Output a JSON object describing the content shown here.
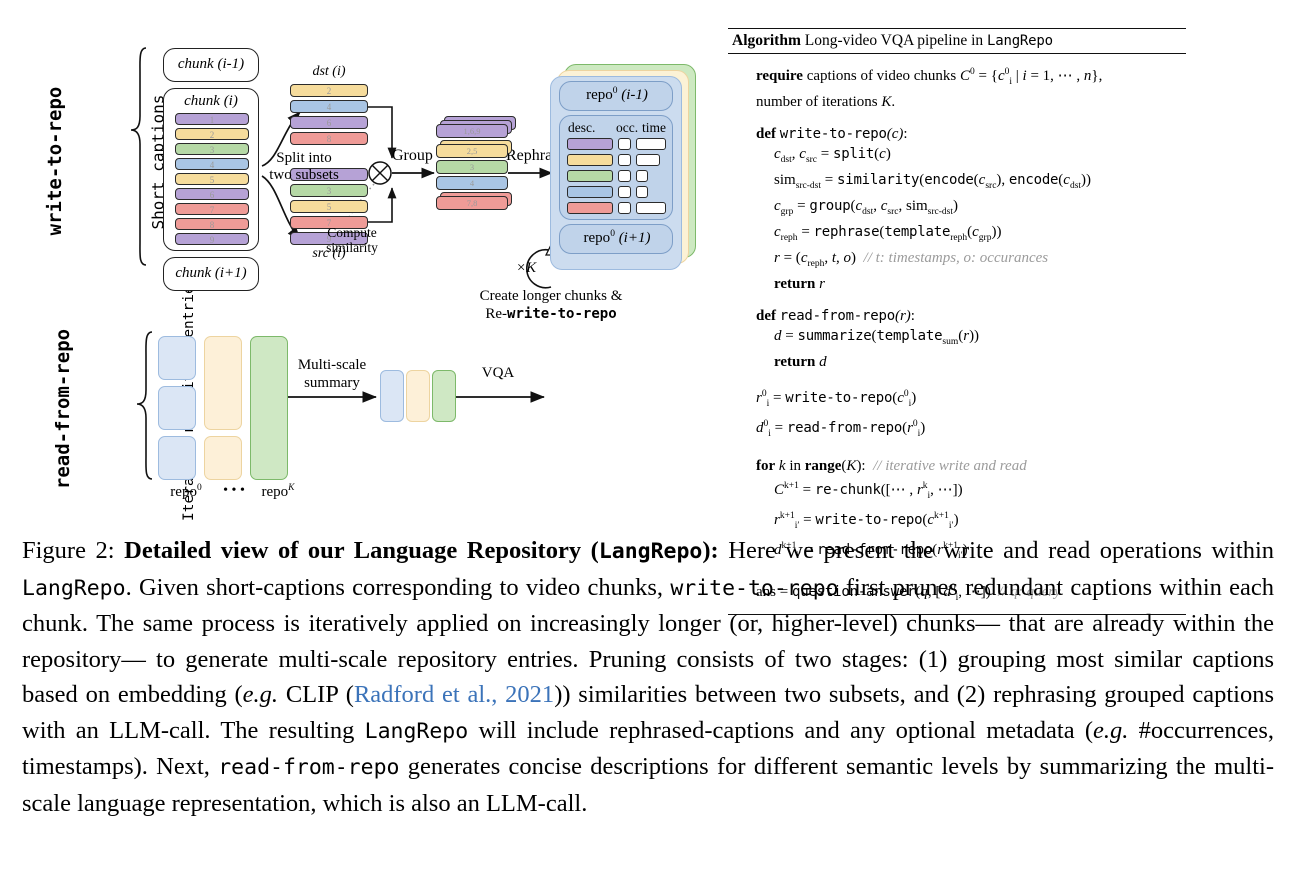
{
  "figure": {
    "label": "Figure 2:",
    "title_bold": "Detailed view of our Language Repository (",
    "title_mono": "LangRepo",
    "title_bold_end": "):",
    "body_1": " Here we present the write and read operations within ",
    "mono_1": "LangRepo",
    "body_2": ". Given short-captions corresponding to video chunks, ",
    "mono_2": "write-to-repo",
    "body_3": " first prunes redundant captions within each chunk. The same process is iteratively applied on increasingly longer (or, higher-level) chunks— that are already within the repository— to generate multi-scale repository entries. Pruning consists of two stages: (1) grouping most similar captions based on embedding (",
    "eg_1": "e.g.",
    "body_4": " CLIP (",
    "citation": "Radford et al., 2021",
    "body_5": ")) similarities between two subsets, and (2) rephrasing grouped captions with an LLM-call. The resulting ",
    "mono_3": "LangRepo",
    "body_6": " will include rephrased-captions and any optional metadata (",
    "eg_2": "e.g.",
    "body_7": " #occurrences, timestamps).  Next, ",
    "mono_4": "read-from-repo",
    "body_8": " generates concise descriptions for different semantic levels by summarizing the multi-scale language representation, which is also an LLM-call."
  },
  "diagram": {
    "write_section_label": "write-to-repo",
    "read_section_label": "read-from-repo",
    "short_captions_label": "Short captions",
    "iterative_entries_label": "Iterative repository entries",
    "chunk_prev": "chunk (i-1)",
    "chunk_cur": "chunk (i)",
    "chunk_next": "chunk (i+1)",
    "dst_label": "dst (i)",
    "src_label": "src (i)",
    "split_label_l1": "Split into",
    "split_label_l2": "two subsets",
    "similarity_op": "⊗",
    "compute_sim_l1": "Compute",
    "compute_sim_l2": "similarity",
    "group_label": "Group",
    "rephrase_label": "Rephrase",
    "repo_prev": "repo",
    "repo_prev_sup": "0",
    "repo_prev_idx": "(i-1)",
    "repo_next": "repo",
    "repo_next_sup": "0",
    "repo_next_idx": "(i+1)",
    "col_desc": "desc.",
    "col_occ": "occ.",
    "col_time": "time",
    "loop_label": "×K",
    "loop_cap_l1": "Create longer chunks &",
    "loop_cap_l2_pre": "Re-",
    "loop_cap_l2_mono": "write-to-repo",
    "multiscale_l1": "Multi-scale",
    "multiscale_l2": "summary",
    "vqa_label": "VQA",
    "repo0_label": "repo",
    "repo0_sup": "0",
    "dots": "• • •",
    "repoK_label": "repo",
    "repoK_sup": "K",
    "chunk_captions": [
      {
        "n": "1",
        "color": "#b6a2d6"
      },
      {
        "n": "2",
        "color": "#f6dc9c"
      },
      {
        "n": "3",
        "color": "#b6d9a6"
      },
      {
        "n": "4",
        "color": "#a9c5e4"
      },
      {
        "n": "5",
        "color": "#f6dc9c"
      },
      {
        "n": "6",
        "color": "#b6a2d6"
      },
      {
        "n": "7",
        "color": "#ef9b97"
      },
      {
        "n": "8",
        "color": "#ef9b97"
      },
      {
        "n": "9",
        "color": "#b6a2d6"
      }
    ],
    "dst_captions": [
      {
        "n": "2",
        "color": "#f6dc9c"
      },
      {
        "n": "4",
        "color": "#a9c5e4"
      },
      {
        "n": "6",
        "color": "#b6a2d6"
      },
      {
        "n": "8",
        "color": "#ef9b97"
      }
    ],
    "src_captions": [
      {
        "n": "1",
        "color": "#b6a2d6"
      },
      {
        "n": "3",
        "color": "#b6d9a6"
      },
      {
        "n": "5",
        "color": "#f6dc9c"
      },
      {
        "n": "7",
        "color": "#ef9b97"
      },
      {
        "n": "9",
        "color": "#b6a2d6"
      }
    ],
    "grouped_captions": [
      {
        "n": "1,6,9",
        "color": "#b6a2d6",
        "stack": 3
      },
      {
        "n": "2,5",
        "color": "#f6dc9c",
        "stack": 2
      },
      {
        "n": "3",
        "color": "#b6d9a6",
        "stack": 1
      },
      {
        "n": "4",
        "color": "#a9c5e4",
        "stack": 1
      },
      {
        "n": "7,8",
        "color": "#ef9b97",
        "stack": 2
      }
    ],
    "repo_rows": [
      {
        "color": "#b6a2d6",
        "time_w": 58
      },
      {
        "color": "#f6dc9c",
        "time_w": 46
      },
      {
        "color": "#b6d9a6",
        "time_w": 24
      },
      {
        "color": "#a9c5e4",
        "time_w": 24
      },
      {
        "color": "#ef9b97",
        "time_w": 58
      }
    ],
    "read_columns": [
      {
        "color": "#dbe6f5",
        "border": "#9dbbdf",
        "segments": [
          3
        ]
      },
      {
        "color": "#fdf0d8",
        "border": "#edd4a0",
        "segments": [
          2
        ]
      },
      {
        "color": "#cfe8c4",
        "border": "#7db96a",
        "segments": [
          1
        ]
      }
    ],
    "summary_blocks": [
      {
        "color": "#dbe6f5",
        "border": "#9dbbdf"
      },
      {
        "color": "#fdf0d8",
        "border": "#edd4a0"
      },
      {
        "color": "#cfe8c4",
        "border": "#7db96a"
      }
    ],
    "colors": {
      "purple": "#b6a2d6",
      "yellow": "#f6dc9c",
      "green": "#b6d9a6",
      "blue": "#a9c5e4",
      "red": "#ef9b97",
      "repo_outer_green": "#cde9c1",
      "repo_mid_yellow": "#fcf2d6",
      "repo_inner_blue": "#ccdcef",
      "repo_block_blue": "#c7d8ec"
    }
  },
  "algorithm": {
    "kw_algorithm": "Algorithm",
    "header_rest": " Long-video VQA pipeline in ",
    "header_mono": "LangRepo",
    "require_kw": "require",
    "require_rest": " captions of video chunks ",
    "require_math": "C⁰ = {c⁰ᵢ | i = 1, ⋯ , n},",
    "require_line2": "number of iterations K.",
    "def_kw": "def",
    "def1_name": "write-to-repo",
    "def1_args": "(c):",
    "l1": "c_dst, c_src = split(c)",
    "l2": "sim_src-dst = similarity(encode(c_src), encode(c_dst))",
    "l3": "c_grp = group(c_dst, c_src, sim_src-dst)",
    "l4": "c_reph = rephrase(template_reph(c_grp))",
    "l5": "r = (c_reph, t, o)",
    "l5_cmt": "// t: timestamps, o: occurances",
    "l6_kw": "return",
    "l6_var": "r",
    "def2_name": "read-from-repo",
    "def2_args": "(r):",
    "l7": "d = summarize(template_sum(r))",
    "l8_kw": "return",
    "l8_var": "d",
    "l9": "r⁰ᵢ = write-to-repo(c⁰ᵢ)",
    "l10": "d⁰ᵢ = read-from-repo(r⁰ᵢ)",
    "for_kw": "for",
    "for_rest": " k in range(K):",
    "for_cmt": "// iterative write and read",
    "l11": "Cᵏ⁺¹ = re-chunk([⋯ , rᵏᵢ, ⋯])",
    "l12": "rᵏ⁺¹ᵢ' = write-to-repo(cᵏ⁺¹ᵢ')",
    "l13": "dᵏ⁺¹ᵢ' = read-from-repo(rᵏ⁺¹ᵢ')",
    "l14": "ans = question-answer(q, [d⁰ᵢ, ⋯])",
    "l14_cmt": "// q: query"
  }
}
